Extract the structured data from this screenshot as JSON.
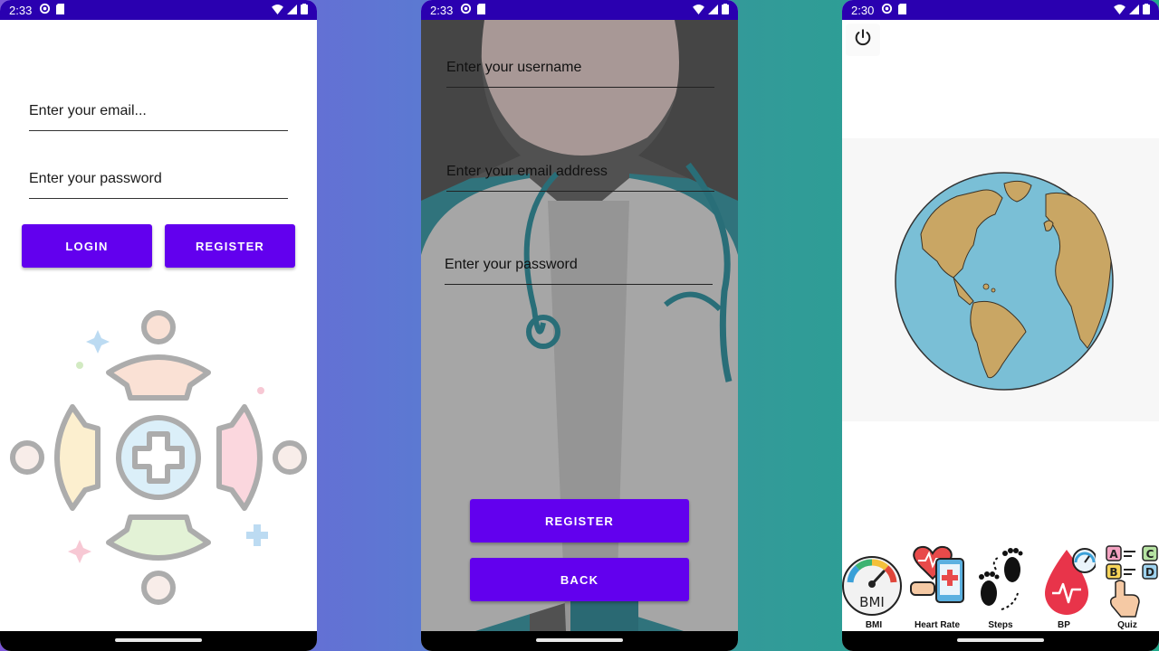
{
  "status_bars": [
    {
      "time": "2:33"
    },
    {
      "time": "2:33"
    },
    {
      "time": "2:30"
    }
  ],
  "login": {
    "email_placeholder": "Enter your email...",
    "password_placeholder": "Enter your password",
    "login_label": "LOGIN",
    "register_label": "REGISTER"
  },
  "register": {
    "username_placeholder": "Enter your username",
    "email_placeholder": "Enter your email address",
    "password_placeholder": "Enter your password",
    "register_label": "REGISTER",
    "back_label": "BACK"
  },
  "home": {
    "power_icon": "power-icon",
    "nav": [
      {
        "label": "BMI",
        "icon": "bmi-gauge-icon"
      },
      {
        "label": "Heart Rate",
        "icon": "heart-rate-icon"
      },
      {
        "label": "Steps",
        "icon": "footsteps-icon"
      },
      {
        "label": "BP",
        "icon": "blood-pressure-icon"
      },
      {
        "label": "Quiz",
        "icon": "quiz-icon"
      }
    ],
    "bmi_gauge_text": "BMI"
  },
  "colors": {
    "primary": "#6200ee",
    "status_bar": "#2a00b0",
    "ocean": "#7abfd6",
    "land": "#c9a664"
  }
}
